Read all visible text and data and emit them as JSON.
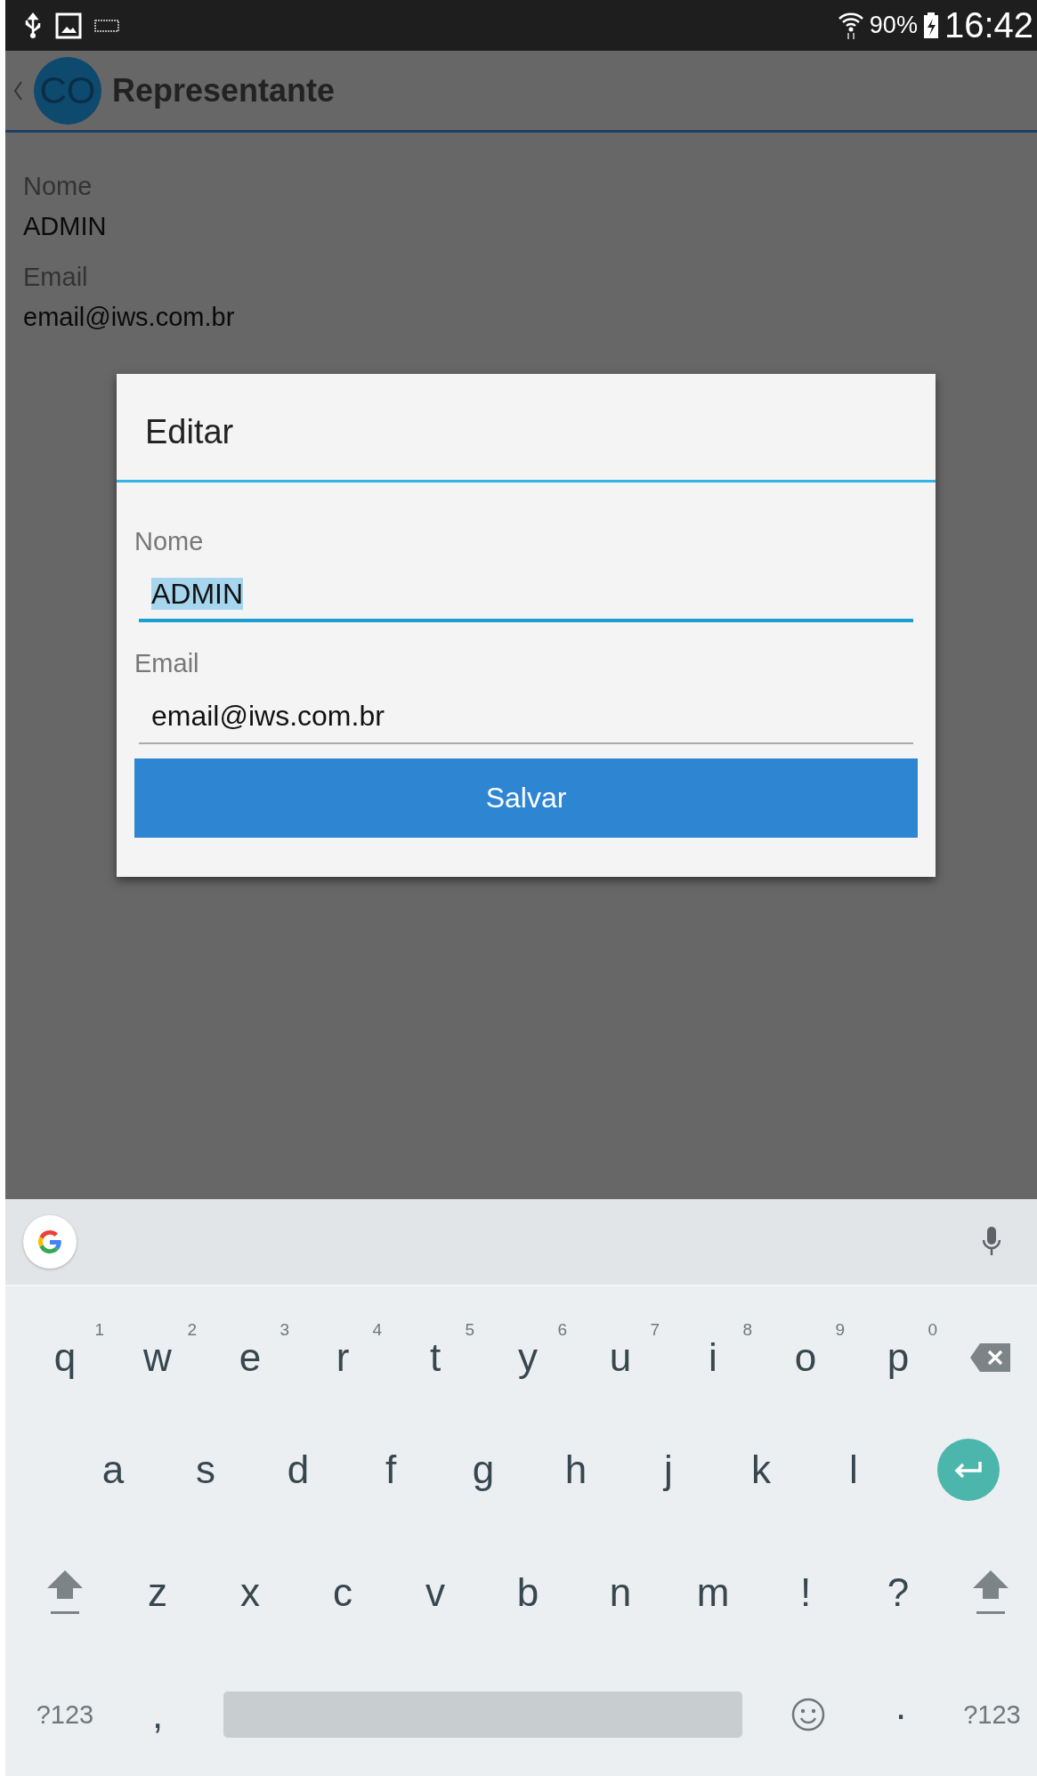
{
  "status_bar": {
    "battery": "90%",
    "time": "16:42"
  },
  "app_bar": {
    "avatar": "CO",
    "title": "Representante"
  },
  "details": [
    {
      "label": "Nome",
      "value": "ADMIN"
    },
    {
      "label": "Email",
      "value": "email@iws.com.br"
    }
  ],
  "dialog": {
    "title": "Editar",
    "fields": [
      {
        "label": "Nome",
        "value": "ADMIN",
        "focused": true,
        "text_selected": true
      },
      {
        "label": "Email",
        "value": "email@iws.com.br",
        "focused": false,
        "text_selected": false
      }
    ],
    "button": "Salvar"
  },
  "keyboard": {
    "rows": [
      {
        "keys": [
          {
            "kind": "char",
            "label": "q",
            "hint": "1"
          },
          {
            "kind": "char",
            "label": "w",
            "hint": "2"
          },
          {
            "kind": "char",
            "label": "e",
            "hint": "3"
          },
          {
            "kind": "char",
            "label": "r",
            "hint": "4"
          },
          {
            "kind": "char",
            "label": "t",
            "hint": "5"
          },
          {
            "kind": "char",
            "label": "y",
            "hint": "6"
          },
          {
            "kind": "char",
            "label": "u",
            "hint": "7"
          },
          {
            "kind": "char",
            "label": "i",
            "hint": "8"
          },
          {
            "kind": "char",
            "label": "o",
            "hint": "9"
          },
          {
            "kind": "char",
            "label": "p",
            "hint": "0"
          },
          {
            "kind": "backspace"
          }
        ]
      },
      {
        "keys": [
          {
            "kind": "char",
            "label": "a"
          },
          {
            "kind": "char",
            "label": "s"
          },
          {
            "kind": "char",
            "label": "d"
          },
          {
            "kind": "char",
            "label": "f"
          },
          {
            "kind": "char",
            "label": "g"
          },
          {
            "kind": "char",
            "label": "h"
          },
          {
            "kind": "char",
            "label": "j"
          },
          {
            "kind": "char",
            "label": "k"
          },
          {
            "kind": "char",
            "label": "l"
          },
          {
            "kind": "enter"
          }
        ]
      },
      {
        "keys": [
          {
            "kind": "shift"
          },
          {
            "kind": "char",
            "label": "z"
          },
          {
            "kind": "char",
            "label": "x"
          },
          {
            "kind": "char",
            "label": "c"
          },
          {
            "kind": "char",
            "label": "v"
          },
          {
            "kind": "char",
            "label": "b"
          },
          {
            "kind": "char",
            "label": "n"
          },
          {
            "kind": "char",
            "label": "m"
          },
          {
            "kind": "char",
            "label": "!"
          },
          {
            "kind": "char",
            "label": "?"
          },
          {
            "kind": "shift"
          }
        ]
      },
      {
        "keys": [
          {
            "kind": "symbols",
            "label": "?123"
          },
          {
            "kind": "char",
            "label": ","
          },
          {
            "kind": "space"
          },
          {
            "kind": "emoji"
          },
          {
            "kind": "char",
            "label": "·"
          },
          {
            "kind": "symbols",
            "label": "?123"
          }
        ]
      }
    ]
  }
}
